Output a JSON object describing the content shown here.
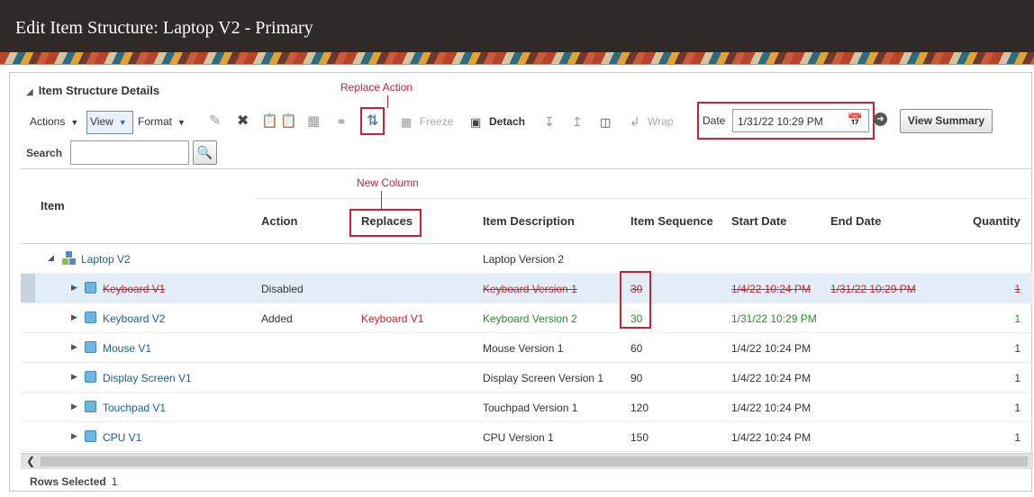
{
  "page": {
    "title": "Edit Item Structure: Laptop V2 - Primary"
  },
  "section": {
    "title": "Item Structure Details"
  },
  "annotations": {
    "replace_action": "Replace Action",
    "new_column": "New Column"
  },
  "toolbar": {
    "actions_label": "Actions",
    "view_label": "View",
    "format_label": "Format",
    "freeze_label": "Freeze",
    "detach_label": "Detach",
    "wrap_label": "Wrap",
    "date_label": "Date",
    "date_value": "1/31/22 10:29 PM",
    "view_summary_label": "View Summary"
  },
  "search": {
    "label": "Search",
    "value": ""
  },
  "table": {
    "headers": {
      "item": "Item",
      "action": "Action",
      "replaces": "Replaces",
      "description": "Item Description",
      "sequence": "Item Sequence",
      "start_date": "Start Date",
      "end_date": "End Date",
      "quantity": "Quantity"
    },
    "root": {
      "item": "Laptop V2",
      "description": "Laptop Version 2"
    },
    "rows": [
      {
        "item": "Keyboard V1",
        "action": "Disabled",
        "replaces": "",
        "description": "Keyboard Version 1",
        "sequence": "30",
        "start_date": "1/4/22 10:24 PM",
        "end_date": "1/31/22 10:29 PM",
        "quantity": "1"
      },
      {
        "item": "Keyboard V2",
        "action": "Added",
        "replaces": "Keyboard V1",
        "description": "Keyboard Version 2",
        "sequence": "30",
        "start_date": "1/31/22 10:29 PM",
        "end_date": "",
        "quantity": "1"
      },
      {
        "item": "Mouse V1",
        "action": "",
        "replaces": "",
        "description": "Mouse Version 1",
        "sequence": "60",
        "start_date": "1/4/22 10:24 PM",
        "end_date": "",
        "quantity": "1"
      },
      {
        "item": "Display Screen V1",
        "action": "",
        "replaces": "",
        "description": "Display Screen Version 1",
        "sequence": "90",
        "start_date": "1/4/22 10:24 PM",
        "end_date": "",
        "quantity": "1"
      },
      {
        "item": "Touchpad V1",
        "action": "",
        "replaces": "",
        "description": "Touchpad Version 1",
        "sequence": "120",
        "start_date": "1/4/22 10:24 PM",
        "end_date": "",
        "quantity": "1"
      },
      {
        "item": "CPU V1",
        "action": "",
        "replaces": "",
        "description": "CPU Version 1",
        "sequence": "150",
        "start_date": "1/4/22 10:24 PM",
        "end_date": "",
        "quantity": "1"
      }
    ]
  },
  "footer": {
    "rows_selected_label": "Rows Selected",
    "rows_selected_value": "1"
  },
  "colors": {
    "annotation_red": "#d0202f",
    "link_blue": "#1a5f95",
    "added_green": "#2b8a2b",
    "header_dark": "#2f2a28"
  }
}
